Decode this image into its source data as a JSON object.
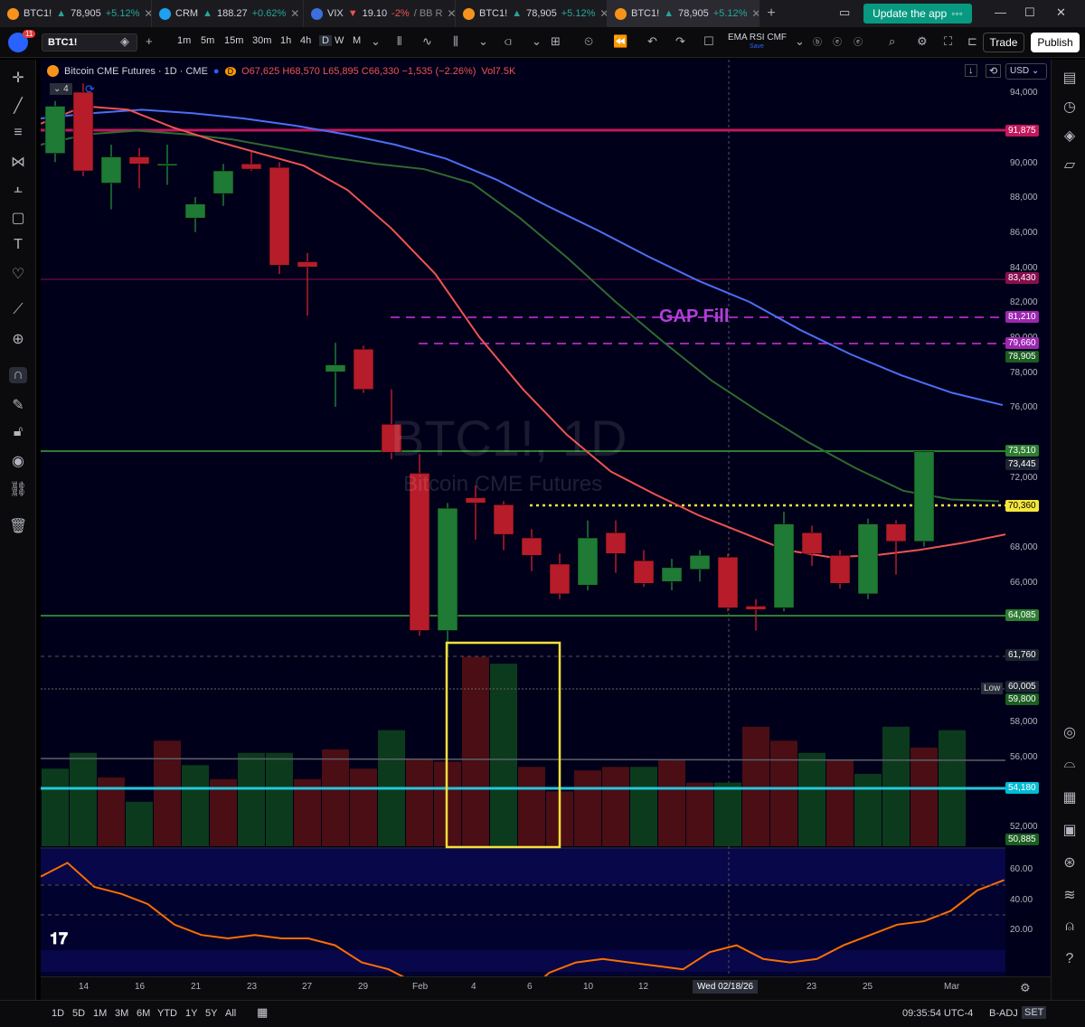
{
  "browser": {
    "tabs": [
      {
        "name": "BTC1!",
        "price": "78,905",
        "change": "+5.12%",
        "dir": "up",
        "color": "#f7931a"
      },
      {
        "name": "CRM",
        "price": "188.27",
        "change": "+0.62%",
        "dir": "up",
        "color": "#1ea1f1"
      },
      {
        "name": "VIX",
        "price": "19.10",
        "change": "-2%",
        "extra": "BB R",
        "dir": "down",
        "color": "#3c6ede"
      },
      {
        "name": "BTC1!",
        "price": "78,905",
        "change": "+5.12%",
        "dir": "up",
        "color": "#f7931a"
      },
      {
        "name": "BTC1!",
        "price": "78,905",
        "change": "+5.12%",
        "dir": "up",
        "color": "#f7931a",
        "active": true
      }
    ],
    "new_tab": "+",
    "update_button": "Update the app"
  },
  "toolbar": {
    "notif_count": "11",
    "symbol": "BTC1!",
    "add": "+",
    "intervals": [
      "1m",
      "5m",
      "15m",
      "30m",
      "1h",
      "4h",
      "D",
      "W",
      "M"
    ],
    "active_interval": "D",
    "indicators": "EMA RSI CMF",
    "indicators_sub": "Save",
    "trade": "Trade",
    "publish": "Publish"
  },
  "legend": {
    "title": "Bitcoin CME Futures · 1D · CME",
    "ohlc": "O67,625 H68,570 L65,895 C66,330 −1,535 (−2.26%)",
    "vol": "Vol7.5K",
    "layers": "4",
    "currency": "USD"
  },
  "watermark": {
    "line1": "BTC1!, 1D",
    "line2": "Bitcoin CME Futures"
  },
  "annotation": "GAP Fill",
  "price_axis": [
    "94,000",
    "90,000",
    "88,000",
    "86,000",
    "84,000",
    "82,000",
    "80,000",
    "78,000",
    "76,000",
    "72,000",
    "68,000",
    "66,000",
    "58,000",
    "56,000",
    "52,000"
  ],
  "price_tags": [
    {
      "text": "91,875",
      "bg": "#c2185b"
    },
    {
      "text": "83,430",
      "bg": "#880e4f"
    },
    {
      "text": "81,210",
      "bg": "#9c27b0"
    },
    {
      "text": "79,660",
      "bg": "#9c27b0"
    },
    {
      "text": "78,905",
      "bg": "#1b5e20"
    },
    {
      "text": "73,510",
      "bg": "#2e7d32"
    },
    {
      "text": "73,445",
      "bg": "#1e2430"
    },
    {
      "text": "70,360",
      "bg": "#f5e63b"
    },
    {
      "text": "64,085",
      "bg": "#2e7d32"
    },
    {
      "text": "61,760",
      "bg": "#1e2430"
    },
    {
      "text": "60,005",
      "bg": "#1e2430"
    },
    {
      "text": "59,800",
      "bg": "#1b5e20"
    },
    {
      "text": "54,180",
      "bg": "#00bcd4"
    },
    {
      "text": "50,885",
      "bg": "#1b5e20"
    }
  ],
  "low_label": "Low",
  "rsi_axis": [
    "60.00",
    "40.00",
    "20.00"
  ],
  "time_axis": [
    "14",
    "16",
    "21",
    "23",
    "27",
    "29",
    "Feb",
    "4",
    "6",
    "10",
    "12",
    "23",
    "25",
    "Mar"
  ],
  "crosshair_date": "Wed 02/18/26",
  "bottom": {
    "ranges": [
      "1D",
      "5D",
      "1M",
      "3M",
      "6M",
      "YTD",
      "1Y",
      "5Y",
      "All"
    ],
    "clock": "09:35:54 UTC-4",
    "adj": "B-ADJ",
    "set": "SET"
  },
  "chart_data": {
    "type": "candlestick",
    "y_range": [
      50000,
      95500
    ],
    "candles": [
      {
        "o": 90500,
        "h": 93500,
        "l": 90000,
        "c": 93200
      },
      {
        "o": 94000,
        "h": 94500,
        "l": 89200,
        "c": 89500
      },
      {
        "o": 88800,
        "h": 91000,
        "l": 87300,
        "c": 90300
      },
      {
        "o": 90300,
        "h": 90800,
        "l": 88500,
        "c": 89900
      },
      {
        "o": 89900,
        "h": 91000,
        "l": 88700,
        "c": 89900
      },
      {
        "o": 86800,
        "h": 88000,
        "l": 86000,
        "c": 87600
      },
      {
        "o": 88200,
        "h": 89900,
        "l": 87500,
        "c": 89500
      },
      {
        "o": 89900,
        "h": 90600,
        "l": 89500,
        "c": 89600
      },
      {
        "o": 89700,
        "h": 90000,
        "l": 83600,
        "c": 84100
      },
      {
        "o": 84300,
        "h": 84800,
        "l": 81210,
        "c": 84000
      },
      {
        "o": 78000,
        "h": 79660,
        "l": 76000,
        "c": 78400
      },
      {
        "o": 79300,
        "h": 79500,
        "l": 76800,
        "c": 77000
      },
      {
        "o": 75000,
        "h": 77000,
        "l": 73000,
        "c": 73400
      },
      {
        "o": 72200,
        "h": 73300,
        "l": 62900,
        "c": 63200
      },
      {
        "o": 63200,
        "h": 70500,
        "l": 61760,
        "c": 70200
      },
      {
        "o": 70800,
        "h": 71500,
        "l": 68400,
        "c": 70500
      },
      {
        "o": 70400,
        "h": 70600,
        "l": 67800,
        "c": 68700
      },
      {
        "o": 68500,
        "h": 69000,
        "l": 66600,
        "c": 67500
      },
      {
        "o": 67000,
        "h": 67600,
        "l": 65000,
        "c": 65300
      },
      {
        "o": 65800,
        "h": 69500,
        "l": 65500,
        "c": 68500
      },
      {
        "o": 68800,
        "h": 69500,
        "l": 66500,
        "c": 67600
      },
      {
        "o": 67200,
        "h": 67800,
        "l": 65700,
        "c": 65900
      },
      {
        "o": 66000,
        "h": 67300,
        "l": 65500,
        "c": 66800
      },
      {
        "o": 66700,
        "h": 67800,
        "l": 66000,
        "c": 67500
      },
      {
        "o": 67400,
        "h": 67600,
        "l": 64300,
        "c": 64500
      },
      {
        "o": 64600,
        "h": 65000,
        "l": 63200,
        "c": 64400
      },
      {
        "o": 64500,
        "h": 70000,
        "l": 64300,
        "c": 69300
      },
      {
        "o": 68800,
        "h": 69200,
        "l": 66900,
        "c": 67600
      },
      {
        "o": 67500,
        "h": 67800,
        "l": 65600,
        "c": 65900
      },
      {
        "o": 65300,
        "h": 69600,
        "l": 65000,
        "c": 69300
      },
      {
        "o": 69300,
        "h": 69500,
        "l": 66400,
        "c": 68300
      },
      {
        "o": 68300,
        "h": 73510,
        "l": 68000,
        "c": 73445
      }
    ],
    "volume_range": [
      50885,
      60000
    ],
    "volumes": [
      {
        "v": 55300,
        "dir": "up"
      },
      {
        "v": 56200,
        "dir": "up"
      },
      {
        "v": 54800,
        "dir": "down"
      },
      {
        "v": 53400,
        "dir": "up"
      },
      {
        "v": 56900,
        "dir": "down"
      },
      {
        "v": 55500,
        "dir": "up"
      },
      {
        "v": 54700,
        "dir": "down"
      },
      {
        "v": 56200,
        "dir": "up"
      },
      {
        "v": 56200,
        "dir": "up"
      },
      {
        "v": 54700,
        "dir": "down"
      },
      {
        "v": 56400,
        "dir": "down"
      },
      {
        "v": 55300,
        "dir": "down"
      },
      {
        "v": 57500,
        "dir": "up"
      },
      {
        "v": 55800,
        "dir": "down"
      },
      {
        "v": 55700,
        "dir": "down"
      },
      {
        "v": 61700,
        "dir": "down"
      },
      {
        "v": 61300,
        "dir": "up"
      },
      {
        "v": 55400,
        "dir": "down"
      },
      {
        "v": 54000,
        "dir": "down"
      },
      {
        "v": 55200,
        "dir": "down"
      },
      {
        "v": 55400,
        "dir": "down"
      },
      {
        "v": 55400,
        "dir": "up"
      },
      {
        "v": 55800,
        "dir": "down"
      },
      {
        "v": 54500,
        "dir": "down"
      },
      {
        "v": 54500,
        "dir": "up"
      },
      {
        "v": 57700,
        "dir": "down"
      },
      {
        "v": 56900,
        "dir": "down"
      },
      {
        "v": 56200,
        "dir": "up"
      },
      {
        "v": 55800,
        "dir": "down"
      },
      {
        "v": 55000,
        "dir": "up"
      },
      {
        "v": 57700,
        "dir": "up"
      },
      {
        "v": 56500,
        "dir": "down"
      },
      {
        "v": 57500,
        "dir": "up"
      }
    ],
    "ema_blue": [
      92500,
      92800,
      93000,
      92800,
      92500,
      92100,
      91600,
      91000,
      90200,
      89000,
      87500,
      86100,
      84600,
      83200,
      82000,
      80400,
      79000,
      77800,
      76800,
      76100
    ],
    "ema_green": [
      91000,
      91600,
      91800,
      91600,
      91300,
      90800,
      90300,
      89900,
      89600,
      88800,
      86800,
      84500,
      82000,
      79700,
      77500,
      75700,
      74000,
      72500,
      71200,
      70700,
      70600
    ],
    "ema_red": [
      92200,
      93200,
      93000,
      92000,
      91200,
      90500,
      89800,
      88400,
      86200,
      83600,
      80000,
      77000,
      74400,
      72300,
      71000,
      69800,
      68800,
      67800,
      67400,
      67500,
      67800,
      68200,
      68700
    ],
    "rsi": [
      58,
      62,
      55,
      53,
      50,
      44,
      41,
      40,
      41,
      40,
      40,
      38,
      33,
      31,
      27,
      24,
      20,
      18,
      23,
      30,
      33,
      34,
      33,
      32,
      31,
      36,
      38,
      34,
      33,
      34,
      38,
      41,
      44,
      45,
      48,
      54,
      57
    ]
  }
}
